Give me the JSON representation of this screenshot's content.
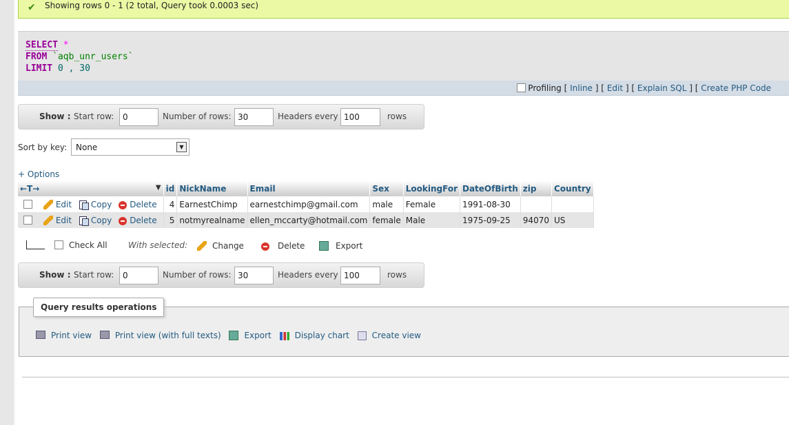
{
  "message": "Showing rows 0 - 1 (2 total, Query took 0.0003 sec)",
  "sql": {
    "select": "SELECT",
    "star": "*",
    "from": "FROM",
    "table": "`aqb_unr_users`",
    "limit": "LIMIT",
    "limit_vals": "0 , 30"
  },
  "tools": {
    "profiling": "Profiling",
    "inline": "Inline",
    "edit": "Edit",
    "explain": "Explain SQL",
    "create": "Create PHP Code",
    "open": "[",
    "close": "]"
  },
  "nav": {
    "show": "Show :",
    "start_row": "Start row:",
    "start_val": "0",
    "num_rows": "Number of rows:",
    "num_val": "30",
    "headers_every": "Headers every",
    "headers_val": "100",
    "rows": "rows"
  },
  "sort": {
    "label": "Sort by key:",
    "value": "None"
  },
  "options_link": "+ Options",
  "table": {
    "col_arrows": "←T→",
    "columns": [
      "id",
      "NickName",
      "Email",
      "Sex",
      "LookingFor",
      "DateOfBirth",
      "zip",
      "Country"
    ],
    "actions": {
      "edit": "Edit",
      "copy": "Copy",
      "delete": "Delete"
    },
    "rows": [
      [
        "4",
        "EarnestChimp",
        "earnestchimp@gmail.com",
        "male",
        "Female",
        "1991-08-30",
        "",
        ""
      ],
      [
        "5",
        "notmyrealname",
        "ellen_mccarty@hotmail.com",
        "female",
        "Male",
        "1975-09-25",
        "94070",
        "US"
      ]
    ]
  },
  "bulk": {
    "check_all": "Check All",
    "with_selected": "With selected:",
    "change": "Change",
    "delete": "Delete",
    "export": "Export"
  },
  "ops": {
    "legend": "Query results operations",
    "print_view": "Print view",
    "print_full": "Print view (with full texts)",
    "export": "Export",
    "display_chart": "Display chart",
    "create_view": "Create view"
  }
}
